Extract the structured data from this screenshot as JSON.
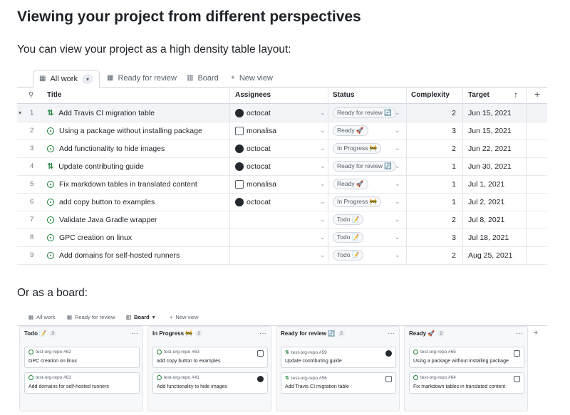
{
  "page": {
    "heading": "Viewing your project from different perspectives",
    "table_intro": "You can view your project as a high density table layout:",
    "board_intro": "Or as a board:"
  },
  "table": {
    "tabs": [
      {
        "label": "All work",
        "icon": "table-icon",
        "active": true
      },
      {
        "label": "Ready for review",
        "icon": "table-icon",
        "active": false
      },
      {
        "label": "Board",
        "icon": "board-icon",
        "active": false
      },
      {
        "label": "New view",
        "icon": "plus-icon",
        "active": false
      }
    ],
    "columns": [
      "Title",
      "Assignees",
      "Status",
      "Complexity",
      "Target"
    ],
    "rows": [
      {
        "n": "1",
        "type": "pr",
        "title": "Add Travis CI migration table",
        "assignee": "octocat",
        "status": "Ready for review 🔄",
        "complexity": "2",
        "target": "Jun 15, 2021"
      },
      {
        "n": "2",
        "type": "issue",
        "title": "Using a package without installing package",
        "assignee": "monalisa",
        "status": "Ready 🚀",
        "complexity": "3",
        "target": "Jun 15, 2021"
      },
      {
        "n": "3",
        "type": "issue",
        "title": "Add functionality to hide images",
        "assignee": "octocat",
        "status": "In Progress 🚧",
        "complexity": "2",
        "target": "Jun 22, 2021"
      },
      {
        "n": "4",
        "type": "pr",
        "title": "Update contributing guide",
        "assignee": "octocat",
        "status": "Ready for review 🔄",
        "complexity": "1",
        "target": "Jun 30, 2021"
      },
      {
        "n": "5",
        "type": "issue",
        "title": "Fix markdown tables in translated content",
        "assignee": "monalisa",
        "status": "Ready 🚀",
        "complexity": "1",
        "target": "Jul 1, 2021"
      },
      {
        "n": "6",
        "type": "issue",
        "title": "add copy button to examples",
        "assignee": "octocat",
        "status": "In Progress 🚧",
        "complexity": "1",
        "target": "Jul 2, 2021"
      },
      {
        "n": "7",
        "type": "issue",
        "title": "Validate Java Gradle wrapper",
        "assignee": "",
        "status": "Todo 📝",
        "complexity": "2",
        "target": "Jul 8, 2021"
      },
      {
        "n": "8",
        "type": "issue",
        "title": "GPC creation on linux",
        "assignee": "",
        "status": "Todo 📝",
        "complexity": "3",
        "target": "Jul 18, 2021"
      },
      {
        "n": "9",
        "type": "issue",
        "title": "Add domains for self-hosted runners",
        "assignee": "",
        "status": "Todo 📝",
        "complexity": "2",
        "target": "Aug 25, 2021"
      }
    ]
  },
  "board": {
    "tabs": [
      {
        "label": "All work",
        "active": false
      },
      {
        "label": "Ready for review",
        "active": false
      },
      {
        "label": "Board",
        "active": true
      },
      {
        "label": "New view",
        "active": false
      }
    ],
    "columns": [
      {
        "title": "Todo 📝",
        "count": "3",
        "cards": [
          {
            "ref": "test-org-repo #62",
            "type": "issue",
            "title": "GPC creation on linux",
            "avatar": ""
          },
          {
            "ref": "test-org-repo #61",
            "type": "issue",
            "title": "Add domains for self-hosted runners",
            "avatar": ""
          }
        ]
      },
      {
        "title": "In Progress 🚧",
        "count": "2",
        "cards": [
          {
            "ref": "test-org-repo #63",
            "type": "issue",
            "title": "add copy button to examples",
            "avatar": "monalisa"
          },
          {
            "ref": "test-org-repo #41",
            "type": "issue",
            "title": "Add functionality to hide images",
            "avatar": "octocat"
          }
        ]
      },
      {
        "title": "Ready for review 🔄",
        "count": "2",
        "cards": [
          {
            "ref": "test-org-repo #59",
            "type": "pr",
            "title": "Update contributing guide",
            "avatar": "octocat"
          },
          {
            "ref": "test-org-repo #56",
            "type": "pr",
            "title": "Add Travis CI migration table",
            "avatar": "monalisa"
          }
        ]
      },
      {
        "title": "Ready 🚀",
        "count": "2",
        "cards": [
          {
            "ref": "test-org-repo #65",
            "type": "issue",
            "title": "Using a package without installing package",
            "avatar": "monalisa"
          },
          {
            "ref": "test-org-repo #64",
            "type": "issue",
            "title": "Fix markdown tables in translated content",
            "avatar": "monalisa"
          }
        ]
      }
    ]
  },
  "colors": {
    "accent_green": "#1a7f37",
    "border": "#d0d7de",
    "muted": "#57606a"
  }
}
